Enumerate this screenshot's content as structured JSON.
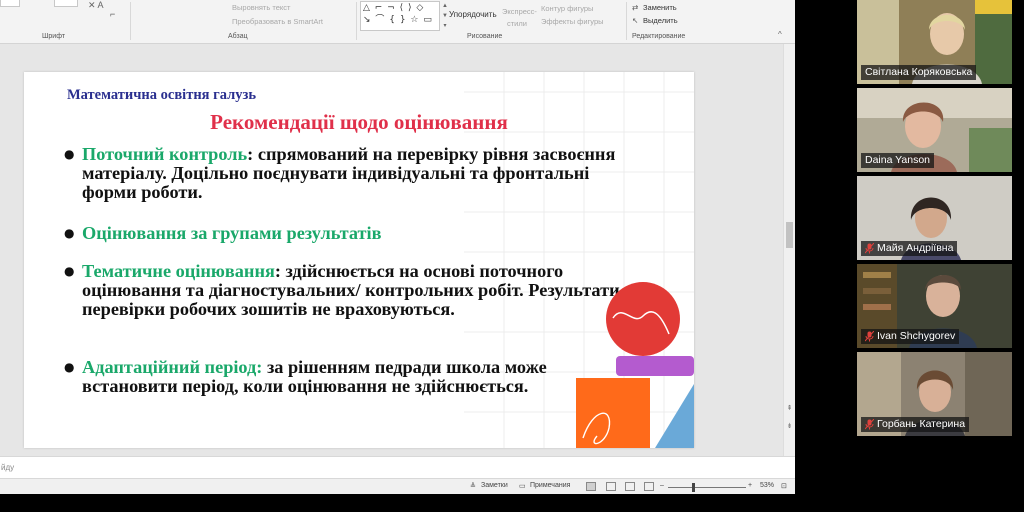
{
  "ribbon": {
    "font_group": "Шрифт",
    "paragraph_group": "Абзац",
    "drawing_group": "Рисование",
    "editing_group": "Редактирование",
    "align_text": "Выровнять текст",
    "convert_smartart": "Преобразовать в SmartArt",
    "arrange": "Упорядочить",
    "express_styles_1": "Экспресс-",
    "express_styles_2": "стили",
    "shape_outline": "Контур фигуры",
    "shape_effects": "Эффекты фигуры",
    "replace": "Заменить",
    "select": "Выделить",
    "shapes_glyphs_row1": "△ ⌐ ¬ ⟨ ⟩ ◇",
    "shapes_glyphs_row2": "↘ ⌒ { } ☆ ▭"
  },
  "notes": {
    "placeholder_fragment": "йду"
  },
  "status": {
    "notes_label": "Заметки",
    "comments_label": "Примечания",
    "zoom_minus": "–",
    "zoom_plus": "+",
    "zoom": "53%"
  },
  "slide": {
    "header": "Математична освітня галузь",
    "title": "Рекомендації щодо оцінювання",
    "bullets": [
      {
        "keyword": "Поточний контроль",
        "text": ": спрямований на перевірку рівня засвоєння матеріалу. Доцільно поєднувати індивідуальні та фронтальні форми роботи."
      },
      {
        "keyword": "Оцінювання за групами результатів",
        "text": ""
      },
      {
        "keyword": "Тематичне оцінювання",
        "text": ": здійснюється на основі поточного оцінювання та діагностувальних/ контрольних робіт. Результати перевірки робочих зошитів не враховуються."
      },
      {
        "keyword": "Адаптаційний період:",
        "text": " за рішенням педради школа може встановити період, коли оцінювання не здійснюється."
      }
    ]
  },
  "participants": [
    {
      "name": "Світлана Коряковська",
      "muted": false,
      "active": true,
      "bg": "#8a7b52"
    },
    {
      "name": "Daina Yanson",
      "muted": false,
      "active": false,
      "bg": "#a09a86"
    },
    {
      "name": "Майя Андріївна",
      "muted": true,
      "active": false,
      "bg": "#c9c6bf"
    },
    {
      "name": "Ivan Shchygorev",
      "muted": true,
      "active": false,
      "bg": "#4b4f3f"
    },
    {
      "name": "Горбань Катерина",
      "muted": true,
      "active": false,
      "bg": "#9a9080"
    }
  ],
  "colors": {
    "accent_green": "#1aa86a",
    "title_red": "#e0304a",
    "header_blue": "#2a2f8f",
    "active_speaker": "#5ad07a",
    "mic_muted": "#e0413c"
  },
  "icons": {
    "mic_muted": "mic-off-icon",
    "bullet": "bullet-dot-icon"
  }
}
